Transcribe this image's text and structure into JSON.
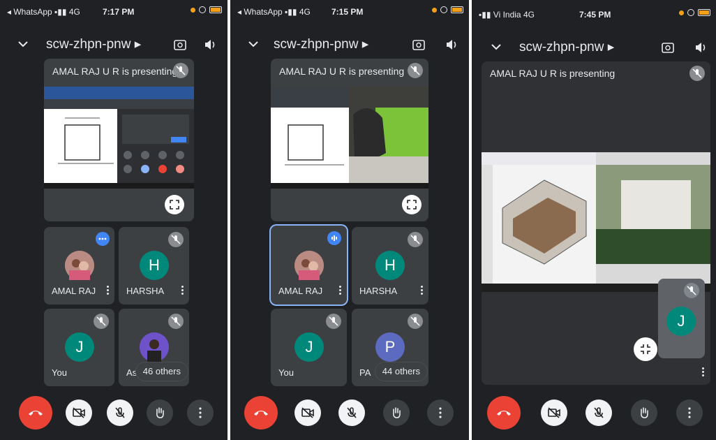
{
  "colors": {
    "bg": "#202124",
    "tile": "#3c4043",
    "end_call": "#ea4335",
    "accent_blue": "#4285f4",
    "avatar_teal": "#00897b",
    "avatar_purple": "#5c6bc0"
  },
  "phones": [
    {
      "status": {
        "carrier": "◂ WhatsApp ▪▮▮ 4G",
        "time": "7:17 PM"
      },
      "meeting_code": "scw-zhpn-pnw ▸",
      "presenting_label": "AMAL RAJ U R is presenting",
      "tiles": [
        {
          "name": "AMAL RAJ",
          "avatar": "photo"
        },
        {
          "name": "HARSHA",
          "initial": "H"
        },
        {
          "name": "You",
          "initial": "J"
        },
        {
          "name": "As",
          "avatar": "photo"
        }
      ],
      "others_label": "46 others"
    },
    {
      "status": {
        "carrier": "◂ WhatsApp ▪▮▮ 4G",
        "time": "7:15 PM"
      },
      "meeting_code": "scw-zhpn-pnw ▸",
      "presenting_label": "AMAL RAJ U R is presenting",
      "tiles": [
        {
          "name": "AMAL RAJ",
          "avatar": "photo"
        },
        {
          "name": "HARSHA",
          "initial": "H"
        },
        {
          "name": "You",
          "initial": "J"
        },
        {
          "name": "PA",
          "initial": "P"
        }
      ],
      "others_label": "44 others"
    },
    {
      "status": {
        "carrier": "▪▮▮ Vi India  4G",
        "time": "7:45 PM"
      },
      "meeting_code": "scw-zhpn-pnw ▸",
      "presenting_label": "AMAL RAJ U R is presenting",
      "self_initial": "J"
    }
  ]
}
